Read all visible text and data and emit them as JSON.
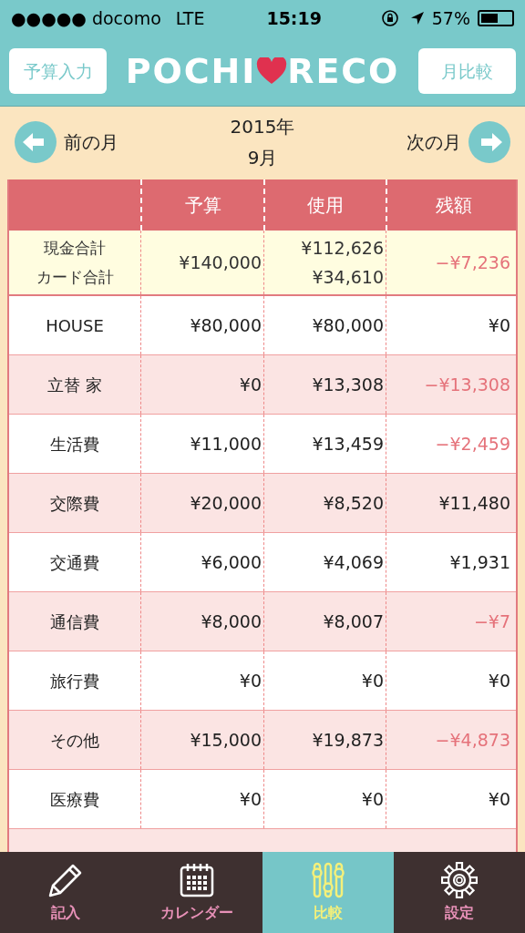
{
  "status_bar": {
    "carrier": "●●●●● docomo",
    "network": "LTE",
    "time": "15:19",
    "battery": "57%"
  },
  "header": {
    "left_button": "予算入力",
    "logo_left": "POCHI",
    "logo_right": "RECO",
    "right_button": "月比較"
  },
  "month_nav": {
    "prev": "前の月",
    "year": "2015年",
    "month": "9月",
    "next": "次の月"
  },
  "table": {
    "columns": [
      "予算",
      "使用",
      "残額"
    ],
    "totals": {
      "labels": [
        "現金合計",
        "カード合計"
      ],
      "budget": "¥140,000",
      "used": [
        "¥112,626",
        "¥34,610"
      ],
      "remaining": "−¥7,236",
      "negative": true
    },
    "rows": [
      {
        "label": "HOUSE",
        "budget": "¥80,000",
        "used": "¥80,000",
        "remaining": "¥0",
        "negative": false
      },
      {
        "label": "立替 家",
        "budget": "¥0",
        "used": "¥13,308",
        "remaining": "−¥13,308",
        "negative": true
      },
      {
        "label": "生活費",
        "budget": "¥11,000",
        "used": "¥13,459",
        "remaining": "−¥2,459",
        "negative": true
      },
      {
        "label": "交際費",
        "budget": "¥20,000",
        "used": "¥8,520",
        "remaining": "¥11,480",
        "negative": false
      },
      {
        "label": "交通費",
        "budget": "¥6,000",
        "used": "¥4,069",
        "remaining": "¥1,931",
        "negative": false
      },
      {
        "label": "通信費",
        "budget": "¥8,000",
        "used": "¥8,007",
        "remaining": "−¥7",
        "negative": true
      },
      {
        "label": "旅行費",
        "budget": "¥0",
        "used": "¥0",
        "remaining": "¥0",
        "negative": false
      },
      {
        "label": "その他",
        "budget": "¥15,000",
        "used": "¥19,873",
        "remaining": "−¥4,873",
        "negative": true
      },
      {
        "label": "医療費",
        "budget": "¥0",
        "used": "¥0",
        "remaining": "¥0",
        "negative": false
      }
    ]
  },
  "tab_bar": [
    {
      "kind": "pencil",
      "label": "記入",
      "selected": false
    },
    {
      "kind": "calendar",
      "label": "カレンダー",
      "selected": false
    },
    {
      "kind": "sliders",
      "label": "比較",
      "selected": true
    },
    {
      "kind": "gear",
      "label": "設定",
      "selected": false
    }
  ]
}
